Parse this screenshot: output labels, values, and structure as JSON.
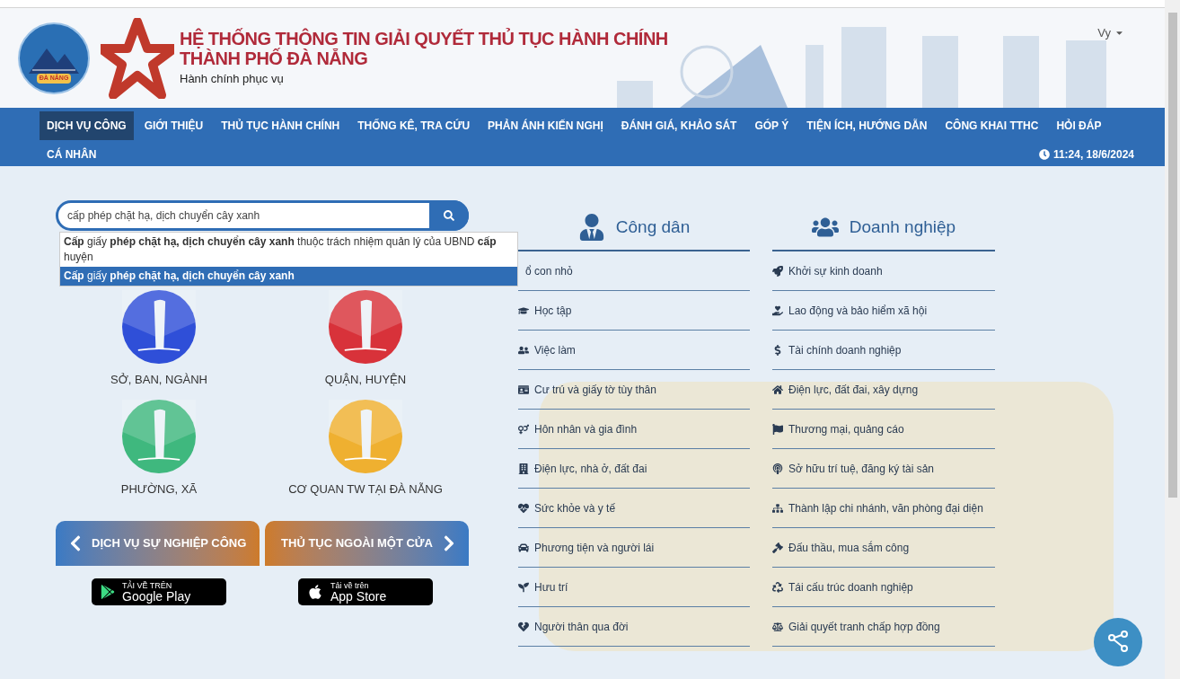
{
  "header": {
    "title_line_1": "HỆ THỐNG THÔNG TIN GIẢI QUYẾT THỦ TỤC HÀNH CHÍNH",
    "title_line_2": "THÀNH PHỐ ĐÀ NẴNG",
    "subtitle": "Hành chính phục vụ",
    "emblem_text": "ĐÀ NẴNG",
    "user_menu": "Vy"
  },
  "nav": {
    "items": [
      {
        "label": "DỊCH VỤ CÔNG",
        "selected": true
      },
      {
        "label": "GIỚI THIỆU",
        "selected": false
      },
      {
        "label": "THỦ TỤC HÀNH CHÍNH",
        "selected": false
      },
      {
        "label": "THỐNG KÊ, TRA CỨU",
        "selected": false
      },
      {
        "label": "PHẢN ÁNH KIẾN NGHỊ",
        "selected": false
      },
      {
        "label": "ĐÁNH GIÁ, KHẢO SÁT",
        "selected": false
      },
      {
        "label": "GÓP Ý",
        "selected": false
      },
      {
        "label": "TIỆN ÍCH, HƯỚNG DẪN",
        "selected": false
      },
      {
        "label": "CÔNG KHAI TTHC",
        "selected": false
      },
      {
        "label": "HỎI ĐÁP",
        "selected": false
      },
      {
        "label": "CÁ NHÂN",
        "selected": false
      }
    ],
    "time": "11:24, 18/6/2024"
  },
  "search": {
    "value": "cấp phép chặt hạ, dịch chuyển cây xanh",
    "suggestions": [
      {
        "text": "**Cấp** giấy **phép chặt hạ, dịch chuyển cây xanh** thuộc trách nhiệm quản lý của UBND **cấp** huyện",
        "selected": false
      },
      {
        "text": "**Cấp** giấy **phép chặt hạ, dịch chuyển cây xanh**",
        "selected": true
      }
    ]
  },
  "units": [
    {
      "label": "SỞ, BAN, NGÀNH",
      "color": "#2f4fd8"
    },
    {
      "label": "QUẬN, HUYỆN",
      "color": "#d8323a"
    },
    {
      "label": "PHƯỜNG, XÃ",
      "color": "#3fb87e"
    },
    {
      "label": "CƠ QUAN TW TẠI ĐÀ NẴNG",
      "color": "#efb030"
    }
  ],
  "banners": [
    {
      "label": "DỊCH VỤ SỰ NGHIỆP CÔNG"
    },
    {
      "label": "THỦ TỤC NGOÀI MỘT CỬA"
    }
  ],
  "app_badges": [
    {
      "caption": "TẢI VỀ TRÊN",
      "store": "Google Play"
    },
    {
      "caption": "Tải về trên",
      "store": "App Store"
    }
  ],
  "citizen": {
    "title": "Công dân",
    "items": [
      "ổ con nhỏ",
      "Học tập",
      "Việc làm",
      "Cư trú và giấy tờ tùy thân",
      "Hôn nhân và gia đình",
      "Điện lực, nhà ở, đất đai",
      "Sức khỏe và y tế",
      "Phương tiện và người lái",
      "Hưu trí",
      "Người thân qua đời"
    ]
  },
  "business": {
    "title": "Doanh nghiệp",
    "items": [
      "Khởi sự kinh doanh",
      "Lao động và bảo hiểm xã hội",
      "Tài chính doanh nghiệp",
      "Điện lực, đất đai, xây dựng",
      "Thương mại, quảng cáo",
      "Sở hữu trí tuệ, đăng ký tài sản",
      "Thành lập chi nhánh, văn phòng đại diện",
      "Đấu thầu, mua sắm công",
      "Tái cấu trúc doanh nghiệp",
      "Giải quyết tranh chấp hợp đồng"
    ]
  }
}
